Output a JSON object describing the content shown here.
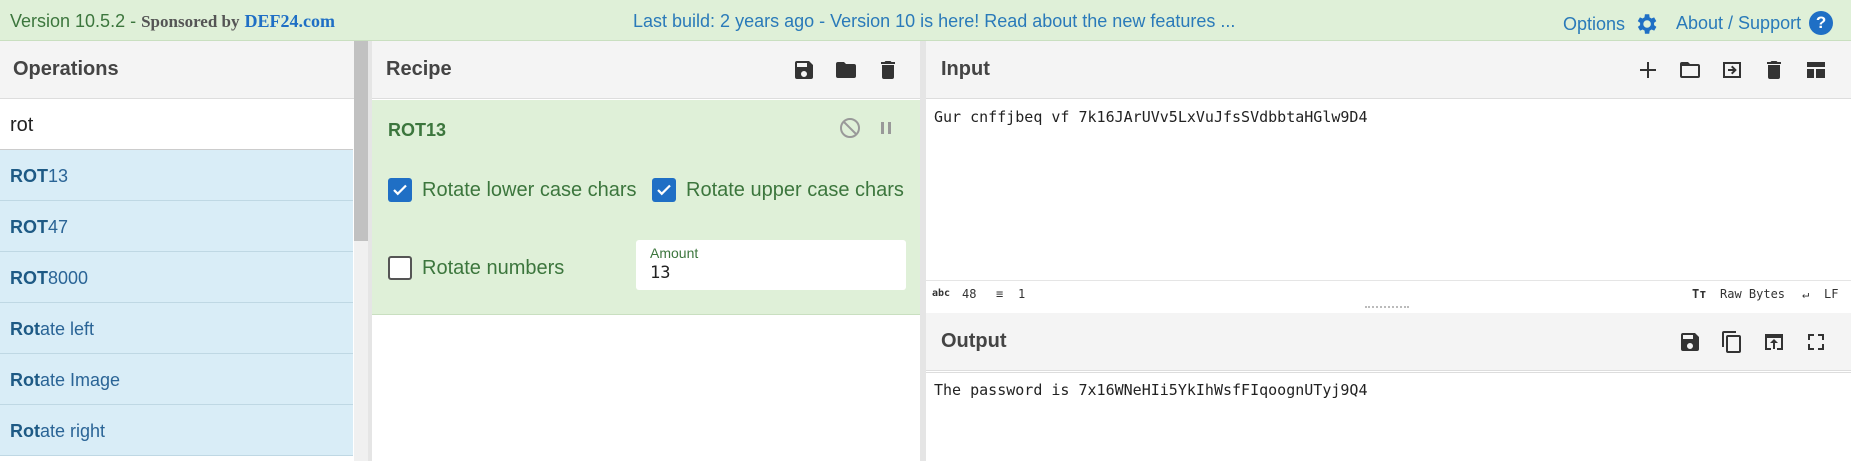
{
  "topbar": {
    "version": "Version 10.5.2 - ",
    "sponsored": "Sponsored by",
    "sponsor": "DEF24.com",
    "notice": "Last build: 2 years ago - Version 10 is here! Read about the new features ...",
    "options": "Options",
    "about": "About / Support"
  },
  "operations": {
    "title": "Operations",
    "search_value": "rot",
    "items": [
      {
        "match": "ROT",
        "rest": "13"
      },
      {
        "match": "ROT",
        "rest": "47"
      },
      {
        "match": "ROT",
        "rest": "8000"
      },
      {
        "match": "Rot",
        "rest": "ate left"
      },
      {
        "match": "Rot",
        "rest": "ate Image"
      },
      {
        "match": "Rot",
        "rest": "ate right"
      }
    ]
  },
  "recipe": {
    "title": "Recipe",
    "ingredient": {
      "name": "ROT13",
      "lower_label": "Rotate lower case chars",
      "lower_checked": true,
      "upper_label": "Rotate upper case chars",
      "upper_checked": true,
      "numbers_label": "Rotate numbers",
      "numbers_checked": false,
      "amount_label": "Amount",
      "amount_value": "13"
    }
  },
  "input": {
    "title": "Input",
    "text": "Gur cnffjbeq vf 7k16JArUVv5LxVuJfsSVdbbtaHGlw9D4",
    "status": {
      "length_icon": "abc",
      "length": "48",
      "lines": "1",
      "raw_bytes": "Raw Bytes",
      "eol": "LF"
    }
  },
  "output": {
    "title": "Output",
    "text": "The password is 7x16WNeHIi5YkIhWsfFIqoognUTyj9Q4"
  }
}
